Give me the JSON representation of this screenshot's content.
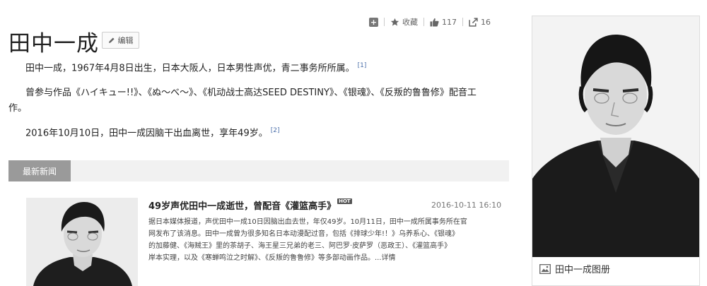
{
  "stats": {
    "plus_icon": "plus-square-icon",
    "favorite_label": "收藏",
    "like_count": "117",
    "share_count": "16"
  },
  "header": {
    "title": "田中一成",
    "edit_label": "编辑"
  },
  "paragraphs": [
    {
      "text": "田中一成，1967年4月8日出生，日本大阪人，日本男性声优，青二事务所所属。",
      "ref": "[1]"
    },
    {
      "text": "曾参与作品《ハイキュー!!》、《ぬ～べ～》、《机动战士高达SEED DESTINY》、《银魂》、《反叛的鲁鲁修》配音工",
      "cont": "作。"
    },
    {
      "text": "2016年10月10日，田中一成因脑干出血离世，享年49岁。",
      "ref": "[2]"
    }
  ],
  "news": {
    "tab_label": "最新新闻",
    "title": "49岁声优田中一成逝世，曾配音《灌篮高手》",
    "hot_label": "HOT",
    "date": "2016-10-11 16:10",
    "body_lines": [
      "据日本媒体报道，声优田中一成10日因脑出血去世，年仅49岁。10月11日，田中一成所属事务所在官",
      "网发布了该消息。田中一成曾为很多知名日本动漫配过音，包括《排球少年!！》乌养系心、《银魂》",
      "的加藤健、《海贼王》里的茶胡子、海王星三兄弟的老三、阿巴罗·皮萨罗（恶政王）、《灌篮高手》",
      "岸本实理，以及《寒蝉鸣泣之时解》、《反叛的鲁鲁修》等多部动画作品。...详情"
    ]
  },
  "card": {
    "album_label": "田中一成图册"
  }
}
